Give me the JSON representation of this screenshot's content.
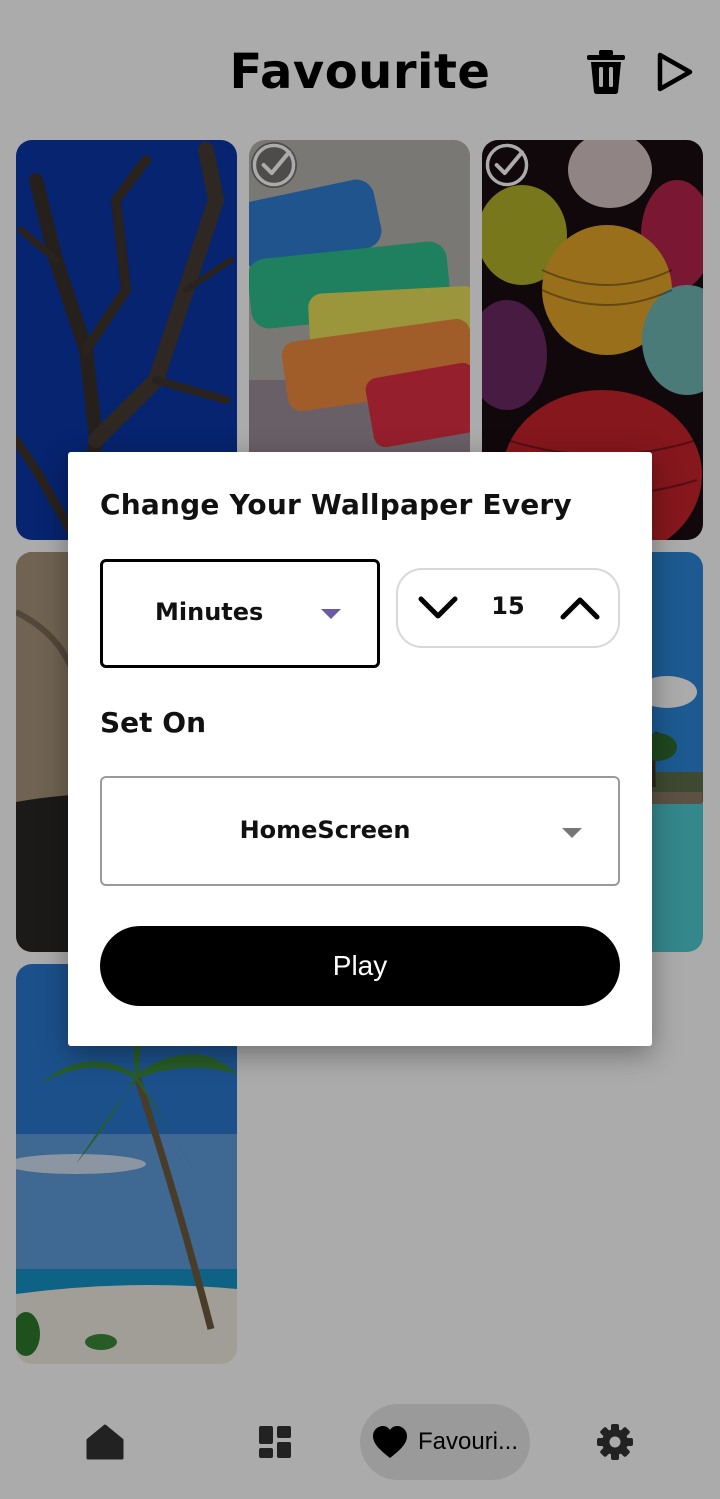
{
  "header": {
    "title": "Favourite",
    "delete_icon": "trash-icon",
    "play_icon": "play-icon"
  },
  "gallery": {
    "items": [
      {
        "name": "tree-branches",
        "selected": false
      },
      {
        "name": "pastel-chalks",
        "selected": true
      },
      {
        "name": "paper-lanterns",
        "selected": true
      },
      {
        "name": "rock-cliff",
        "selected": false
      },
      {
        "name": "lagoon-resort",
        "selected": false
      },
      {
        "name": "palm-beach",
        "selected": false
      }
    ]
  },
  "dialog": {
    "title": "Change Your Wallpaper Every",
    "interval_unit": "Minutes",
    "interval_value": "15",
    "set_on_label": "Set On",
    "set_on_value": "HomeScreen",
    "play_label": "Play"
  },
  "bottom_nav": {
    "items": [
      {
        "icon": "home-icon",
        "label": ""
      },
      {
        "icon": "categories-icon",
        "label": ""
      },
      {
        "icon": "heart-icon",
        "label": "Favouri..."
      },
      {
        "icon": "gear-icon",
        "label": ""
      }
    ]
  },
  "colors": {
    "accent_caret": "#6b5aa3",
    "primary": "#000000",
    "scrim": "rgba(0,0,0,0.33)"
  }
}
